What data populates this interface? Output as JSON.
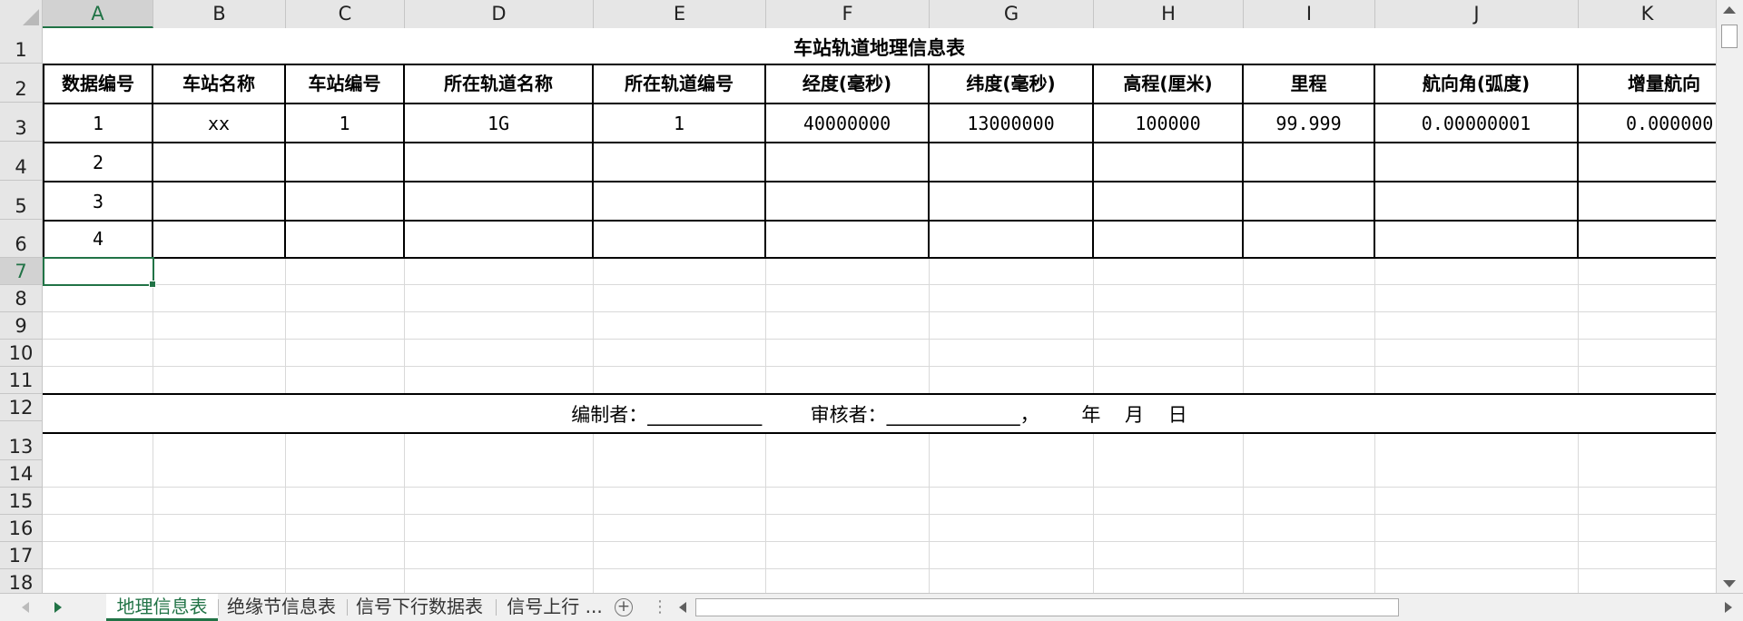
{
  "columns": [
    "A",
    "B",
    "C",
    "D",
    "E",
    "F",
    "G",
    "H",
    "I",
    "J",
    "K"
  ],
  "active_column": "A",
  "rows": [
    "1",
    "2",
    "3",
    "4",
    "5",
    "6",
    "7",
    "8",
    "9",
    "10",
    "11",
    "12",
    "13",
    "14",
    "15",
    "16",
    "17",
    "18"
  ],
  "active_row": "7",
  "table": {
    "title": "车站轨道地理信息表",
    "headers": [
      "数据编号",
      "车站名称",
      "车站编号",
      "所在轨道名称",
      "所在轨道编号",
      "经度(毫秒)",
      "纬度(毫秒)",
      "高程(厘米)",
      "里程",
      "航向角(弧度)",
      "增量航向"
    ],
    "data_rows": [
      [
        "1",
        "xx",
        "1",
        "1G",
        "1",
        "40000000",
        "13000000",
        "100000",
        "99.999",
        "0.00000001",
        "0.000000"
      ],
      [
        "2",
        "",
        "",
        "",
        "",
        "",
        "",
        "",
        "",
        "",
        ""
      ],
      [
        "3",
        "",
        "",
        "",
        "",
        "",
        "",
        "",
        "",
        "",
        ""
      ],
      [
        "4",
        "",
        "",
        "",
        "",
        "",
        "",
        "",
        "",
        "",
        ""
      ]
    ]
  },
  "footer": {
    "compiler_label": "编制者：____________",
    "reviewer_label": "审核者：______________，",
    "date_label": "年    月    日"
  },
  "selected_cell": "A7",
  "sheet_tabs": [
    "地理信息表",
    "绝缘节信息表",
    "信号下行数据表",
    "信号上行 ..."
  ],
  "active_tab": "地理信息表",
  "add_sheet_symbol": "+"
}
